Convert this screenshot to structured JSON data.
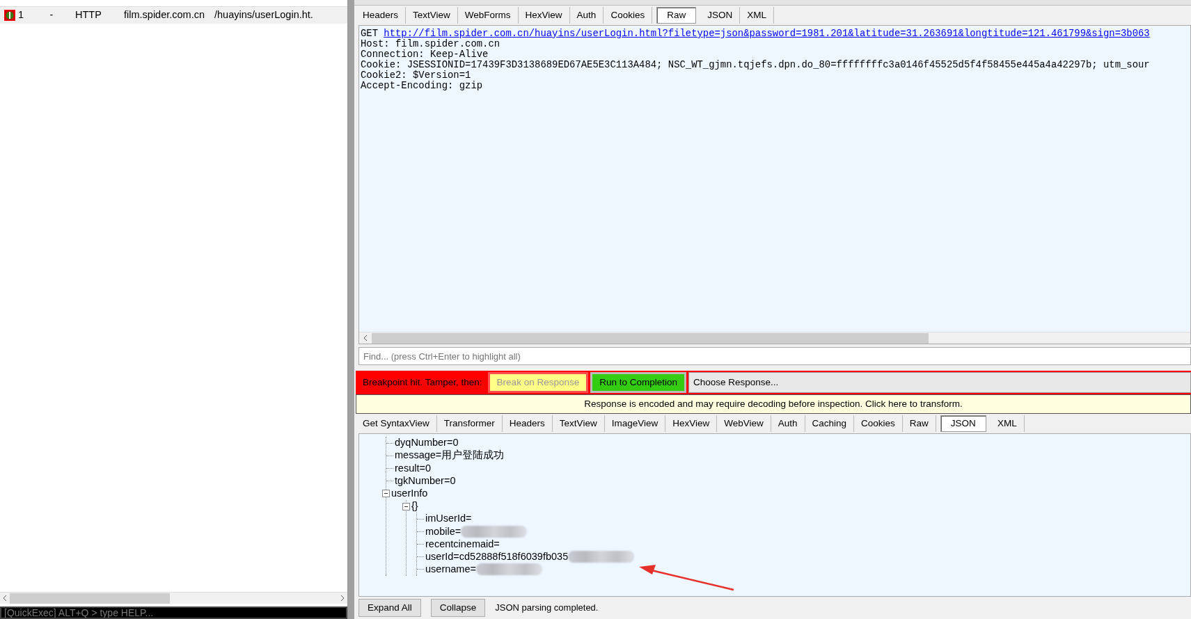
{
  "sessions": {
    "rows": [
      {
        "number": "1",
        "result": "-",
        "protocol": "HTTP",
        "host": "film.spider.com.cn",
        "url": "/huayins/userLogin.ht.",
        "selected": true,
        "breakpoint": true
      }
    ]
  },
  "quickexec": {
    "placeholder": "[QuickExec] ALT+Q > type HELP..."
  },
  "request_tabs": [
    {
      "label": "Headers",
      "selected": false
    },
    {
      "label": "TextView",
      "selected": false
    },
    {
      "label": "WebForms",
      "selected": false
    },
    {
      "label": "HexView",
      "selected": false
    },
    {
      "label": "Auth",
      "selected": false
    },
    {
      "label": "Cookies",
      "selected": false
    },
    {
      "label": "Raw",
      "selected": true
    },
    {
      "label": "JSON",
      "selected": false
    },
    {
      "label": "XML",
      "selected": false
    }
  ],
  "raw_request": {
    "method": "GET",
    "url": "http://film.spider.com.cn/huayins/userLogin.html?filetype=json&password=1981.201&latitude=31.263691&longtitude=121.461799&sign=3b063",
    "lines": [
      "Host: film.spider.com.cn",
      "Connection: Keep-Alive",
      "Cookie: JSESSIONID=17439F3D3138689ED67AE5E3C113A484; NSC_WT_gjmn.tqjefs.dpn.do_80=ffffffffc3a0146f45525d5f4f58455e445a4a42297b; utm_sour",
      "Cookie2: $Version=1",
      "Accept-Encoding: gzip"
    ]
  },
  "find": {
    "placeholder": "Find... (press Ctrl+Enter to highlight all)"
  },
  "breakpoint_bar": {
    "label": "Breakpoint hit. Tamper, then:",
    "buttons": [
      {
        "label": "Break on Response",
        "kind": "disabled"
      },
      {
        "label": "Run to Completion",
        "kind": "go"
      }
    ],
    "choose_response": "Choose Response..."
  },
  "notice": "Response is encoded and may require decoding before inspection. Click here to transform.",
  "response_tabs": [
    {
      "label": "Get SyntaxView",
      "selected": false
    },
    {
      "label": "Transformer",
      "selected": false
    },
    {
      "label": "Headers",
      "selected": false
    },
    {
      "label": "TextView",
      "selected": false
    },
    {
      "label": "ImageView",
      "selected": false
    },
    {
      "label": "HexView",
      "selected": false
    },
    {
      "label": "WebView",
      "selected": false
    },
    {
      "label": "Auth",
      "selected": false
    },
    {
      "label": "Caching",
      "selected": false
    },
    {
      "label": "Cookies",
      "selected": false
    },
    {
      "label": "Raw",
      "selected": false
    },
    {
      "label": "JSON",
      "selected": true
    },
    {
      "label": "XML",
      "selected": false
    }
  ],
  "json_tree": [
    {
      "label": "dyqNumber=0"
    },
    {
      "label": "message=用户登陆成功"
    },
    {
      "label": "result=0"
    },
    {
      "label": "tgkNumber=0"
    },
    {
      "label": "userInfo",
      "expanded": true,
      "children": [
        {
          "label": "{}",
          "expanded": true,
          "children": [
            {
              "label": "imUserId="
            },
            {
              "label": "mobile=",
              "redacted": true
            },
            {
              "label": "recentcinemaid="
            },
            {
              "label": "userId=cd52888f518f6039fb035",
              "redacted": true
            },
            {
              "label": "username=",
              "redacted": true
            }
          ]
        }
      ]
    }
  ],
  "bottom_buttons": [
    "Expand All",
    "Collapse"
  ],
  "status": "JSON parsing completed."
}
